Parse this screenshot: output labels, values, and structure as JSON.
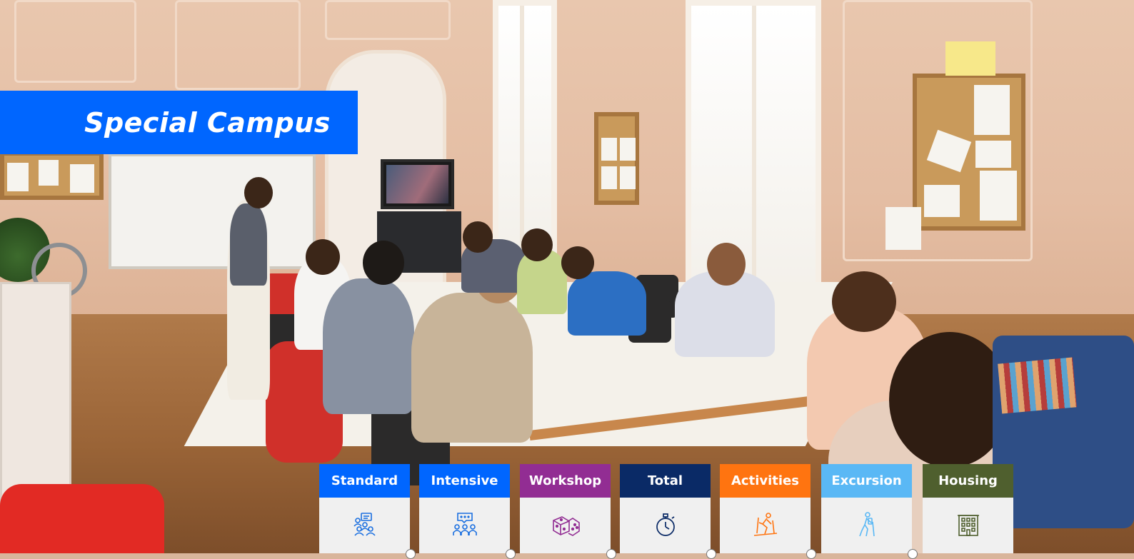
{
  "banner": {
    "title": "Special Campus",
    "color": "#0066ff"
  },
  "courses": [
    {
      "label": "Standard",
      "color": "#0066ff",
      "icon": "group-presentation-icon",
      "icon_color": "#1a6fe0"
    },
    {
      "label": "Intensive",
      "color": "#0066ff",
      "icon": "group-chat-icon",
      "icon_color": "#1a6fe0"
    },
    {
      "label": "Workshop",
      "color": "#922d93",
      "icon": "dice-icon",
      "icon_color": "#922d93"
    },
    {
      "label": "Total",
      "color": "#0a2a66",
      "icon": "stopwatch-icon",
      "icon_color": "#0a2a66"
    },
    {
      "label": "Activities",
      "color": "#ff7410",
      "icon": "skiing-icon",
      "icon_color": "#ff7410"
    },
    {
      "label": "Excursion",
      "color": "#5ab8f5",
      "icon": "hiker-icon",
      "icon_color": "#5ab8f5"
    },
    {
      "label": "Housing",
      "color": "#4f5f2e",
      "icon": "building-icon",
      "icon_color": "#4f5f2e"
    }
  ]
}
